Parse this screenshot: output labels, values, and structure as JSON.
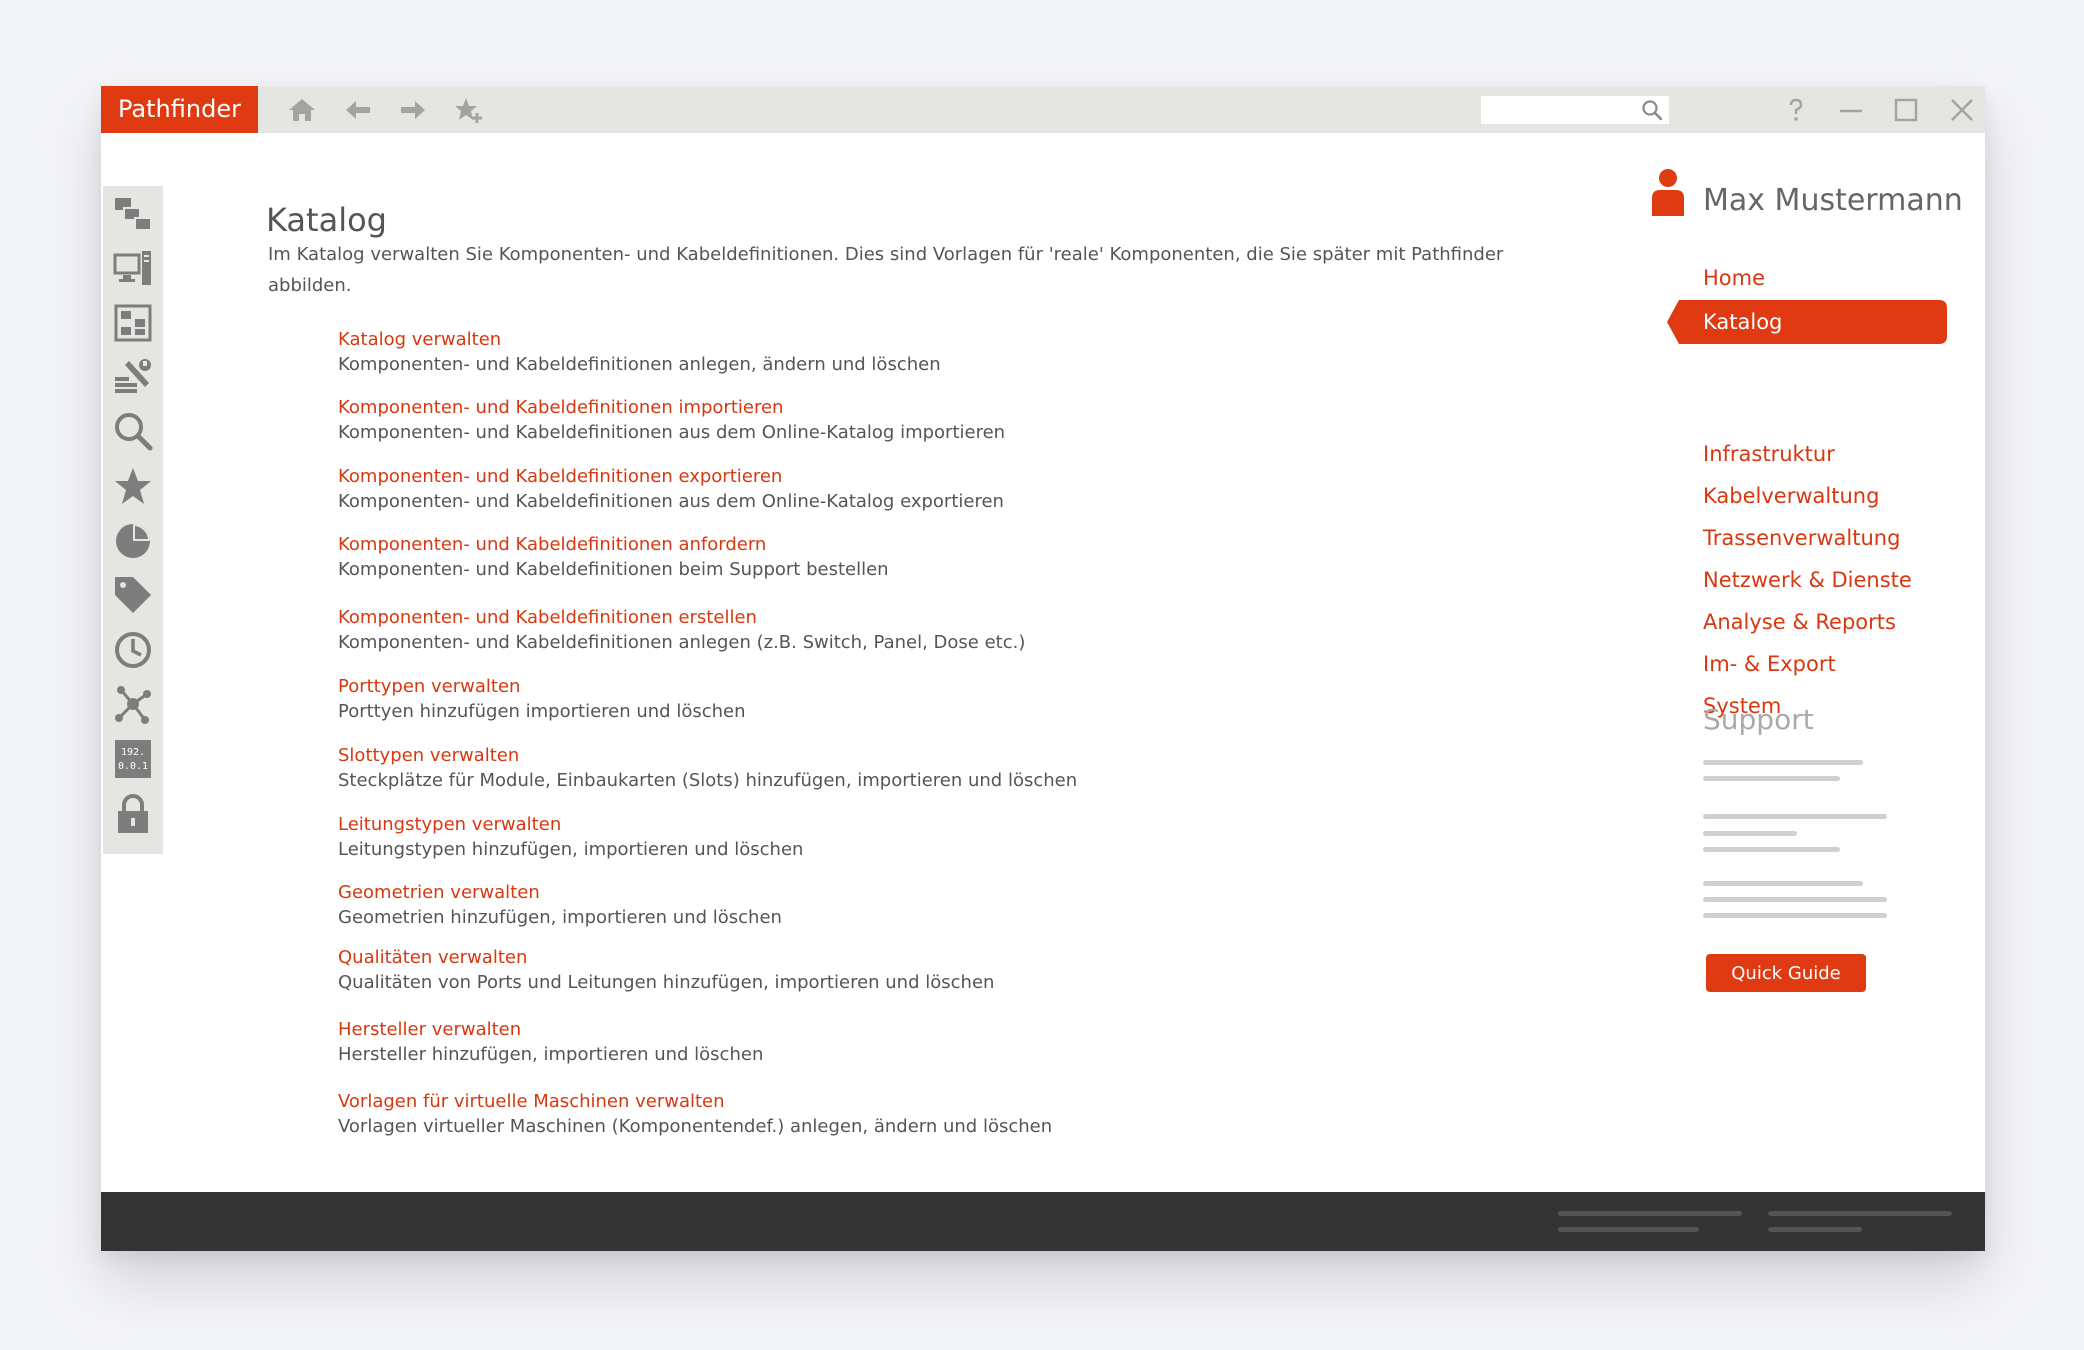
{
  "app": {
    "brand": "Pathfinder"
  },
  "toolbar": {
    "icons": [
      "home-icon",
      "arrow-left-icon",
      "arrow-right-icon",
      "star-plus-icon"
    ],
    "search_placeholder": "",
    "window_controls": [
      "help-icon",
      "minimize-icon",
      "maximize-icon",
      "close-icon"
    ]
  },
  "sidebar_icons": [
    "catalog-components-icon",
    "devices-icon",
    "rack-layout-icon",
    "tools-icon",
    "search-icon",
    "star-icon",
    "pie-chart-icon",
    "tag-icon",
    "clock-icon",
    "network-icon",
    "ip-address-icon",
    "lock-icon"
  ],
  "ip_icon_text": {
    "line1": "192.",
    "line2": "0.0.1"
  },
  "main": {
    "title": "Katalog",
    "intro": "Im Katalog verwalten Sie Komponenten- und Kabeldefinitionen. Dies sind Vorlagen für 'reale' Komponenten, die Sie später mit Pathfinder abbilden.",
    "entries": [
      {
        "link": "Katalog verwalten",
        "desc": "Komponenten- und Kabeldefinitionen anlegen, ändern und löschen"
      },
      {
        "link": "Komponenten- und Kabeldefinitionen importieren",
        "desc": "Komponenten- und Kabeldefinitionen aus dem Online-Katalog importieren"
      },
      {
        "link": "Komponenten- und Kabeldefinitionen exportieren",
        "desc": "Komponenten- und Kabeldefinitionen aus dem Online-Katalog exportieren"
      },
      {
        "link": "Komponenten- und Kabeldefinitionen anfordern",
        "desc": "Komponenten- und Kabeldefinitionen beim Support bestellen"
      },
      {
        "link": "Komponenten- und Kabeldefinitionen erstellen",
        "desc": "Komponenten- und Kabeldefinitionen anlegen (z.B. Switch, Panel, Dose etc.)"
      },
      {
        "link": "Porttypen verwalten",
        "desc": "Porttyen hinzufügen importieren und löschen"
      },
      {
        "link": "Slottypen verwalten",
        "desc": "Steckplätze für Module, Einbaukarten (Slots) hinzufügen, importieren und löschen"
      },
      {
        "link": "Leitungstypen verwalten",
        "desc": "Leitungstypen hinzufügen, importieren und löschen"
      },
      {
        "link": "Geometrien verwalten",
        "desc": "Geometrien hinzufügen, importieren und löschen"
      },
      {
        "link": "Qualitäten verwalten",
        "desc": "Qualitäten von Ports und Leitungen hinzufügen, importieren und löschen"
      },
      {
        "link": "Hersteller verwalten",
        "desc": "Hersteller hinzufügen, importieren und löschen"
      },
      {
        "link": "Vorlagen für virtuelle Maschinen verwalten",
        "desc": "Vorlagen virtueller Maschinen (Komponentendef.) anlegen, ändern und löschen"
      }
    ]
  },
  "user": {
    "name": "Max Mustermann",
    "icon": "user-icon"
  },
  "nav": {
    "items": [
      {
        "label": "Home",
        "active": false
      },
      {
        "label": "Katalog",
        "active": true
      },
      {
        "label": "Infrastruktur",
        "active": false
      },
      {
        "label": "Kabelverwaltung",
        "active": false
      },
      {
        "label": "Trassenverwaltung",
        "active": false
      },
      {
        "label": "Netzwerk & Dienste",
        "active": false
      },
      {
        "label": "Analyse & Reports",
        "active": false
      },
      {
        "label": "Im- & Export",
        "active": false
      },
      {
        "label": "System",
        "active": false
      }
    ]
  },
  "support": {
    "title": "Support",
    "button": "Quick Guide"
  },
  "colors": {
    "accent": "#e03a12",
    "link": "#d8380f",
    "text": "#555555",
    "bar": "#e5e5e1",
    "footer": "#333333"
  }
}
